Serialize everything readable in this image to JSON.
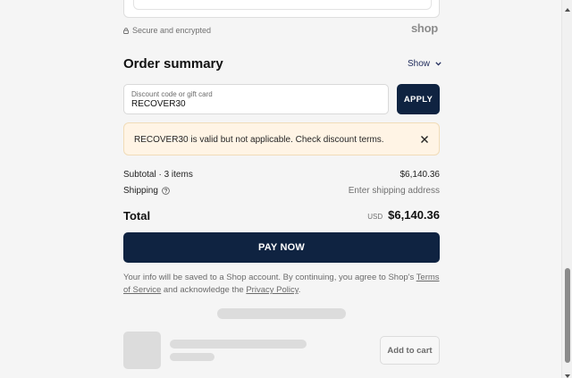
{
  "secure_note": "Secure and encrypted",
  "shop_logo": "shop",
  "order_summary": {
    "title": "Order summary",
    "show_toggle": "Show"
  },
  "discount": {
    "label": "Discount code or gift card",
    "value": "RECOVER30",
    "apply_label": "APPLY"
  },
  "alert": {
    "message": "RECOVER30 is valid but not applicable. Check discount terms."
  },
  "subtotal": {
    "label": "Subtotal · 3 items",
    "value": "$6,140.36"
  },
  "shipping": {
    "label": "Shipping",
    "value": "Enter shipping address"
  },
  "total": {
    "label": "Total",
    "currency": "USD",
    "value": "$6,140.36"
  },
  "pay_button": "PAY NOW",
  "legal": {
    "prefix": "Your info will be saved to a Shop account. By continuing, you agree to Shop's ",
    "terms_link": "Terms of Service",
    "middle": " and acknowledge the ",
    "privacy_link": "Privacy Policy",
    "suffix": "."
  },
  "recommendation": {
    "add_to_cart": "Add to cart"
  },
  "colors": {
    "primary": "#0f2341",
    "alert_bg": "#fff4e5",
    "background": "#f5f5f5"
  }
}
